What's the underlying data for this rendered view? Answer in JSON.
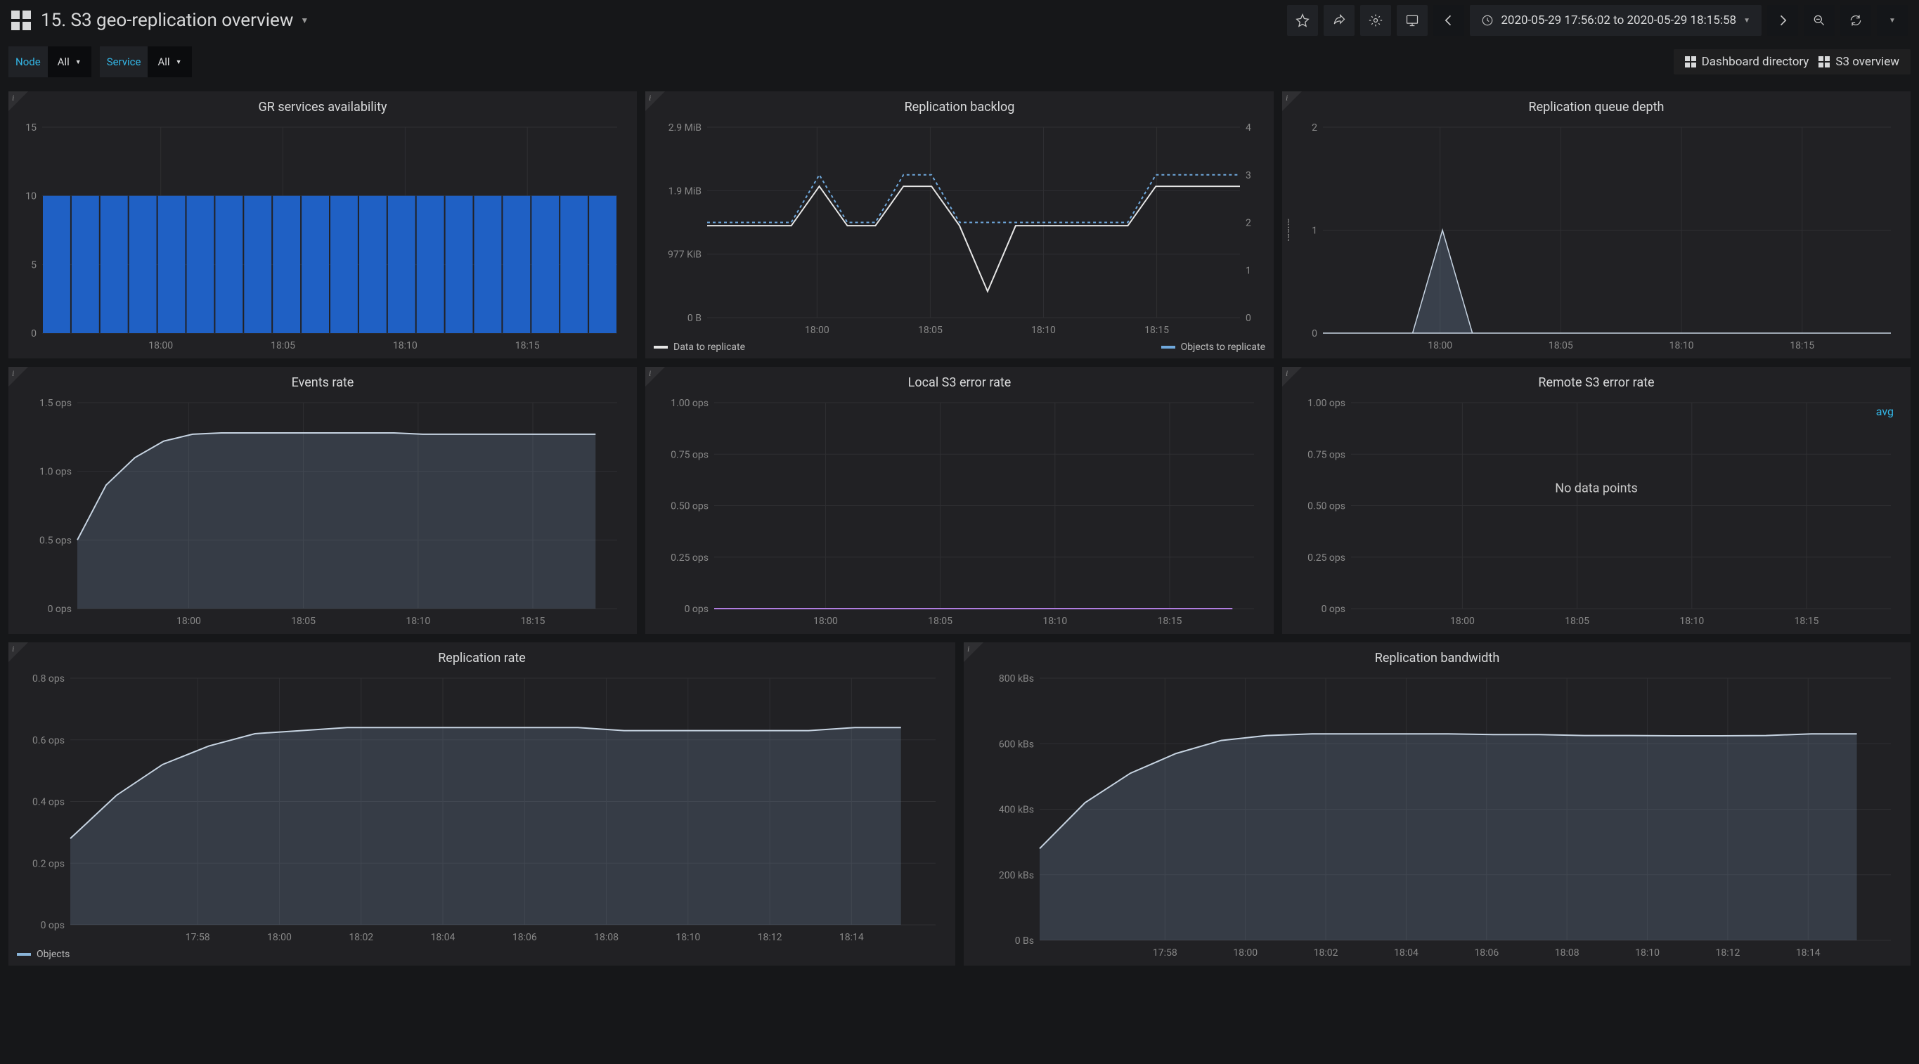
{
  "header": {
    "title": "15. S3 geo-replication overview",
    "time_range": "2020-05-29 17:56:02 to 2020-05-29 18:15:58"
  },
  "vars": {
    "node_label": "Node",
    "node_value": "All",
    "service_label": "Service",
    "service_value": "All"
  },
  "links": {
    "dashboard_directory": "Dashboard directory",
    "s3_overview": "S3 overview"
  },
  "panels": {
    "gr_avail": "GR services availability",
    "backlog": "Replication backlog",
    "queue": "Replication queue depth",
    "events": "Events rate",
    "local_err": "Local S3 error rate",
    "remote_err": "Remote S3 error rate",
    "repl_rate": "Replication rate",
    "repl_bw": "Replication bandwidth"
  },
  "legends": {
    "data_to_replicate": "Data to replicate",
    "objects_to_replicate": "Objects to replicate",
    "objects": "Objects"
  },
  "labels": {
    "tasks": "tasks",
    "no_data": "No data points",
    "avg": "avg"
  },
  "chart_data": [
    {
      "id": "gr_avail",
      "type": "bar",
      "title": "GR services availability",
      "x_ticks": [
        "18:00",
        "18:05",
        "18:10",
        "18:15"
      ],
      "y_ticks": [
        0,
        5,
        10,
        15
      ],
      "ylim": [
        0,
        15
      ],
      "categories": [
        "17:56",
        "17:57",
        "17:58",
        "17:59",
        "18:00",
        "18:01",
        "18:02",
        "18:03",
        "18:04",
        "18:05",
        "18:06",
        "18:07",
        "18:08",
        "18:09",
        "18:10",
        "18:11",
        "18:12",
        "18:13",
        "18:14",
        "18:15"
      ],
      "values": [
        10,
        10,
        10,
        10,
        10,
        10,
        10,
        10,
        10,
        10,
        10,
        10,
        10,
        10,
        10,
        10,
        10,
        10,
        10,
        10
      ]
    },
    {
      "id": "backlog",
      "type": "line",
      "title": "Replication backlog",
      "x_ticks": [
        "18:00",
        "18:05",
        "18:10",
        "18:15"
      ],
      "y_left_labels": [
        "0 B",
        "977 KiB",
        "1.9 MiB",
        "2.9 MiB"
      ],
      "y_right_labels": [
        "0",
        "1",
        "2",
        "3",
        "4"
      ],
      "ylim_right": [
        0,
        4
      ],
      "series": [
        {
          "name": "Data to replicate",
          "axis": "left",
          "color": "#e6e6e6",
          "x": [
            "17:56",
            "17:57",
            "17:58",
            "17:59",
            "18:00",
            "18:01",
            "18:02",
            "18:03",
            "18:04",
            "18:05",
            "18:06",
            "18:07",
            "18:08",
            "18:09",
            "18:10",
            "18:11",
            "18:12",
            "18:13",
            "18:14",
            "18:15"
          ],
          "values_label": [
            "1.4 MiB",
            "1.4 MiB",
            "1.4 MiB",
            "1.4 MiB",
            "2.0 MiB",
            "1.4 MiB",
            "1.4 MiB",
            "2.0 MiB",
            "2.0 MiB",
            "1.4 MiB",
            "0.4 MiB",
            "1.4 MiB",
            "1.4 MiB",
            "1.4 MiB",
            "1.4 MiB",
            "1.4 MiB",
            "2.0 MiB",
            "2.0 MiB",
            "2.0 MiB",
            "2.0 MiB"
          ]
        },
        {
          "name": "Objects to replicate",
          "axis": "right",
          "color": "#6fa8dc",
          "dash": true,
          "x": [
            "17:56",
            "17:57",
            "17:58",
            "17:59",
            "18:00",
            "18:01",
            "18:02",
            "18:03",
            "18:04",
            "18:05",
            "18:06",
            "18:07",
            "18:08",
            "18:09",
            "18:10",
            "18:11",
            "18:12",
            "18:13",
            "18:14",
            "18:15"
          ],
          "values": [
            2,
            2,
            2,
            2,
            3,
            2,
            2,
            3,
            3,
            2,
            2,
            2,
            2,
            2,
            2,
            2,
            3,
            3,
            3,
            3
          ]
        }
      ]
    },
    {
      "id": "queue",
      "type": "area",
      "title": "Replication queue depth",
      "x_ticks": [
        "18:00",
        "18:05",
        "18:10",
        "18:15"
      ],
      "y_ticks": [
        0,
        1,
        2
      ],
      "ylim": [
        0,
        2
      ],
      "ylabel": "tasks",
      "x": [
        "17:56",
        "17:57",
        "17:58",
        "17:59",
        "18:00",
        "18:01",
        "18:02",
        "18:03",
        "18:04",
        "18:05",
        "18:06",
        "18:07",
        "18:08",
        "18:09",
        "18:10",
        "18:11",
        "18:12",
        "18:13",
        "18:14",
        "18:15"
      ],
      "values": [
        0,
        0,
        0,
        0,
        1,
        0,
        0,
        0,
        0,
        0,
        0,
        0,
        0,
        0,
        0,
        0,
        0,
        0,
        0,
        0
      ]
    },
    {
      "id": "events",
      "type": "area",
      "title": "Events rate",
      "x_ticks": [
        "18:00",
        "18:05",
        "18:10",
        "18:15"
      ],
      "y_tick_labels": [
        "0 ops",
        "0.5 ops",
        "1.0 ops",
        "1.5 ops"
      ],
      "ylim": [
        0,
        1.5
      ],
      "x": [
        "17:56",
        "17:57",
        "17:58",
        "17:59",
        "18:00",
        "18:01",
        "18:02",
        "18:03",
        "18:04",
        "18:05",
        "18:06",
        "18:07",
        "18:08",
        "18:09",
        "18:10",
        "18:11",
        "18:12",
        "18:13",
        "18:14"
      ],
      "values": [
        0.5,
        0.9,
        1.1,
        1.22,
        1.27,
        1.28,
        1.28,
        1.28,
        1.28,
        1.28,
        1.28,
        1.28,
        1.27,
        1.27,
        1.27,
        1.27,
        1.27,
        1.27,
        1.27
      ]
    },
    {
      "id": "local_err",
      "type": "line",
      "title": "Local S3 error rate",
      "x_ticks": [
        "18:00",
        "18:05",
        "18:10",
        "18:15"
      ],
      "y_tick_labels": [
        "0 ops",
        "0.25 ops",
        "0.50 ops",
        "0.75 ops",
        "1.00 ops"
      ],
      "ylim": [
        0,
        1.0
      ],
      "x": [
        "17:56",
        "17:57",
        "17:58",
        "17:59",
        "18:00",
        "18:01",
        "18:02",
        "18:03",
        "18:04",
        "18:05",
        "18:06",
        "18:07",
        "18:08",
        "18:09",
        "18:10",
        "18:11",
        "18:12",
        "18:13",
        "18:14"
      ],
      "values": [
        0,
        0,
        0,
        0,
        0,
        0,
        0,
        0,
        0,
        0,
        0,
        0,
        0,
        0,
        0,
        0,
        0,
        0,
        0
      ]
    },
    {
      "id": "remote_err",
      "type": "line",
      "title": "Remote S3 error rate",
      "x_ticks": [
        "18:00",
        "18:05",
        "18:10",
        "18:15"
      ],
      "y_tick_labels": [
        "0 ops",
        "0.25 ops",
        "0.50 ops",
        "0.75 ops",
        "1.00 ops"
      ],
      "ylim": [
        0,
        1.0
      ],
      "no_data": true,
      "avg_legend": "avg"
    },
    {
      "id": "repl_rate",
      "type": "area",
      "title": "Replication rate",
      "x_ticks": [
        "17:58",
        "18:00",
        "18:02",
        "18:04",
        "18:06",
        "18:08",
        "18:10",
        "18:12",
        "18:14"
      ],
      "y_tick_labels": [
        "0 ops",
        "0.2 ops",
        "0.4 ops",
        "0.6 ops",
        "0.8 ops"
      ],
      "ylim": [
        0,
        0.8
      ],
      "series": [
        {
          "name": "Objects",
          "color": "#8ab4d8"
        }
      ],
      "x": [
        "17:56",
        "17:57",
        "17:58",
        "17:59",
        "18:00",
        "18:01",
        "18:02",
        "18:03",
        "18:04",
        "18:05",
        "18:06",
        "18:07",
        "18:08",
        "18:09",
        "18:10",
        "18:11",
        "18:12",
        "18:13",
        "18:14"
      ],
      "values": [
        0.28,
        0.42,
        0.52,
        0.58,
        0.62,
        0.63,
        0.64,
        0.64,
        0.64,
        0.64,
        0.64,
        0.64,
        0.63,
        0.63,
        0.63,
        0.63,
        0.63,
        0.64,
        0.64
      ]
    },
    {
      "id": "repl_bw",
      "type": "area",
      "title": "Replication bandwidth",
      "x_ticks": [
        "17:58",
        "18:00",
        "18:02",
        "18:04",
        "18:06",
        "18:08",
        "18:10",
        "18:12",
        "18:14"
      ],
      "y_tick_labels": [
        "0 Bs",
        "200 kBs",
        "400 kBs",
        "600 kBs",
        "800 kBs"
      ],
      "ylim": [
        0,
        800
      ],
      "x": [
        "17:56",
        "17:57",
        "17:58",
        "17:59",
        "18:00",
        "18:01",
        "18:02",
        "18:03",
        "18:04",
        "18:05",
        "18:06",
        "18:07",
        "18:08",
        "18:09",
        "18:10",
        "18:11",
        "18:12",
        "18:13",
        "18:14"
      ],
      "values": [
        280,
        420,
        510,
        570,
        610,
        625,
        630,
        630,
        630,
        630,
        628,
        628,
        625,
        625,
        624,
        624,
        625,
        630,
        630
      ]
    }
  ]
}
